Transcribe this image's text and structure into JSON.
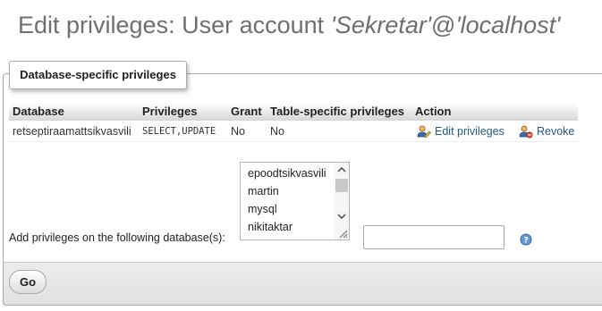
{
  "page": {
    "title_prefix": "Edit privileges: User account ",
    "user": "'Sekretar'",
    "at": "@",
    "host": "'localhost'"
  },
  "fieldset": {
    "legend": "Database-specific privileges"
  },
  "table": {
    "headers": [
      "Database",
      "Privileges",
      "Grant",
      "Table-specific privileges",
      "Action"
    ],
    "rows": [
      {
        "database": "retseptiraamattsikvasvili",
        "privileges": "SELECT,UPDATE",
        "grant": "No",
        "table_specific": "No",
        "edit_label": "Edit privileges",
        "revoke_label": "Revoke"
      }
    ]
  },
  "database_select": {
    "options": [
      "epoodtsikvasvili",
      "martin",
      "mysql",
      "nikitaktar"
    ]
  },
  "add_privileges": {
    "label": "Add privileges on the following database(s):",
    "input_value": ""
  },
  "footer": {
    "go_label": "Go"
  },
  "icons": {
    "edit": "edit-privileges-icon",
    "revoke": "revoke-user-icon",
    "help": "help-icon"
  }
}
